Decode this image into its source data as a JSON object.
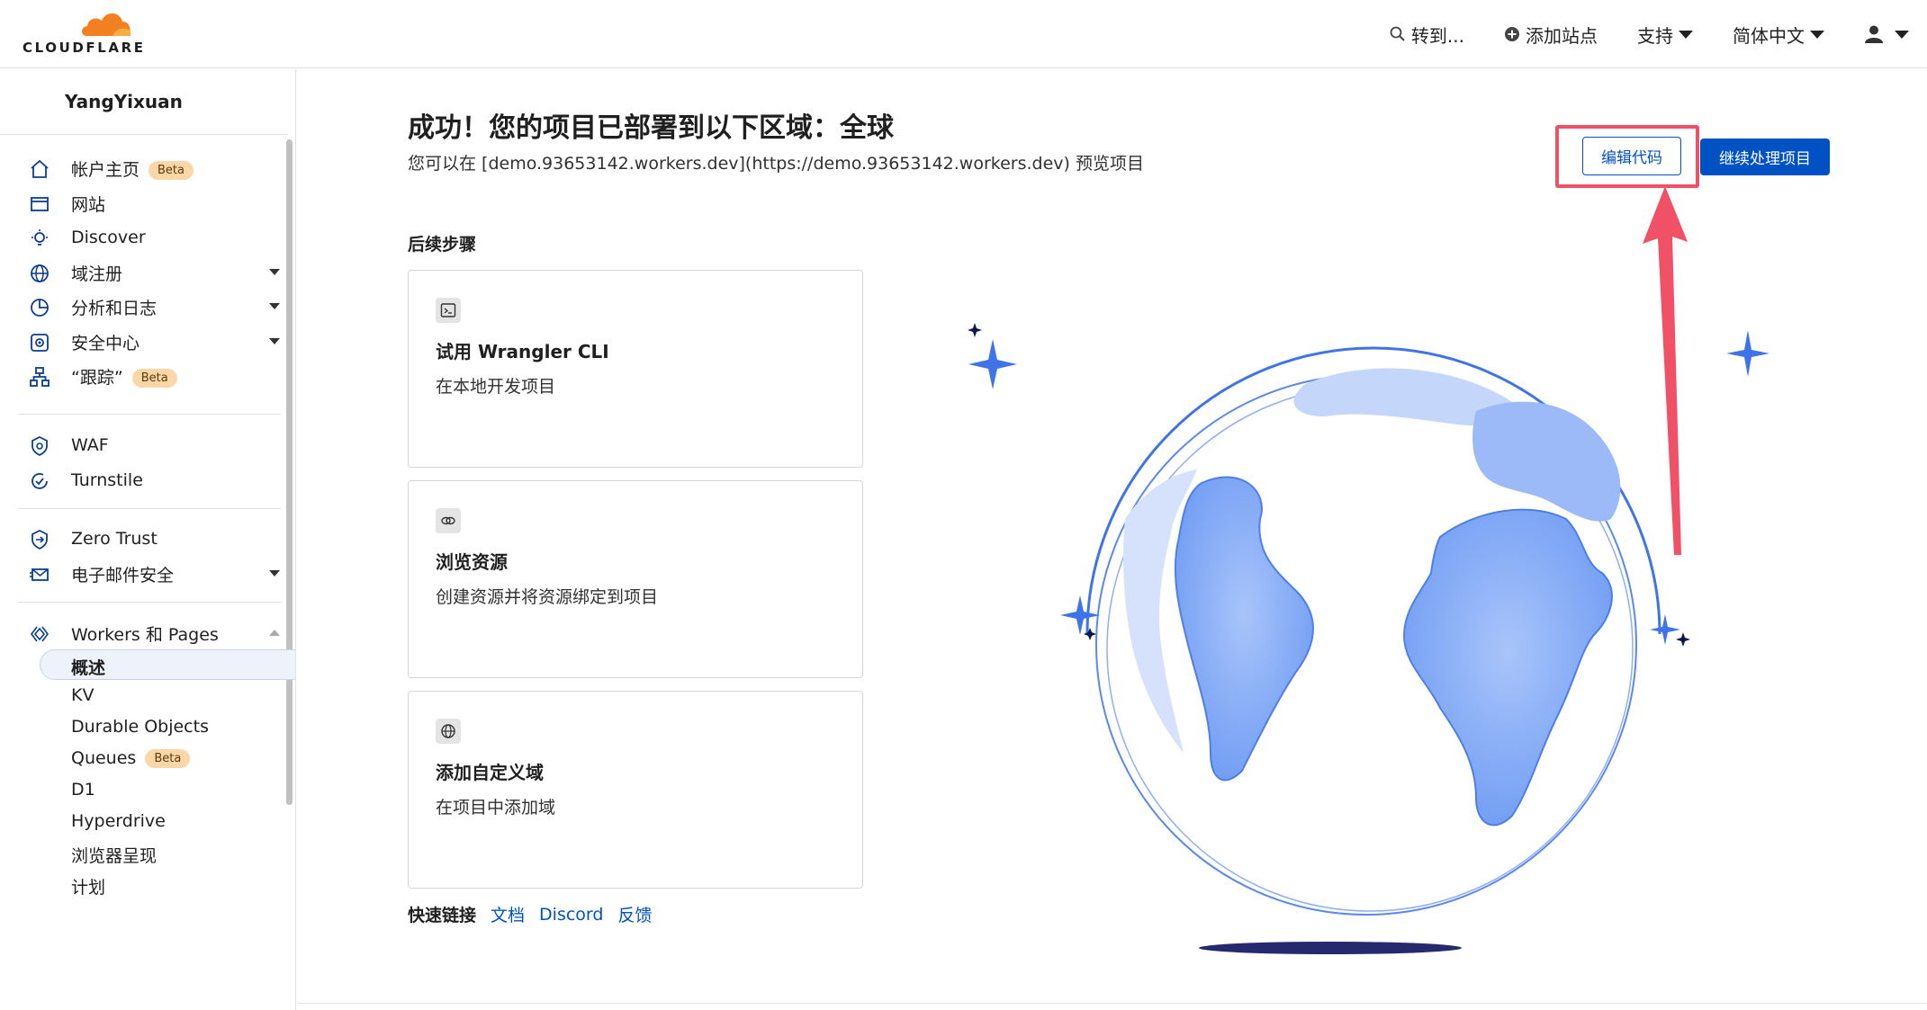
{
  "brand": {
    "logo_text": "CLOUDFLARE",
    "orange": "#f38020",
    "accent_blue": "#0051c3"
  },
  "topnav": {
    "search_label": "转到...",
    "add_site_label": "添加站点",
    "support_label": "支持",
    "language_label": "简体中文",
    "user_icon": "user-icon"
  },
  "sidebar": {
    "account_name": "YangYixuan",
    "items": [
      {
        "label": "帐户主页",
        "icon": "home-icon",
        "badge": "Beta"
      },
      {
        "label": "网站",
        "icon": "browser-window-icon"
      },
      {
        "label": "Discover",
        "icon": "lightbulb-icon"
      },
      {
        "label": "域注册",
        "icon": "globe-icon"
      },
      {
        "label": "分析和日志",
        "icon": "pie-chart-icon"
      },
      {
        "label": "安全中心",
        "icon": "security-center-icon"
      },
      {
        "label": "“跟踪”",
        "icon": "sitemap-icon",
        "badge": "Beta"
      },
      {
        "label": "WAF",
        "icon": "waf-shield-icon"
      },
      {
        "label": "Turnstile",
        "icon": "turnstile-icon"
      },
      {
        "label": "Zero Trust",
        "icon": "zero-trust-icon"
      },
      {
        "label": "电子邮件安全",
        "icon": "email-icon"
      },
      {
        "label": "Workers 和 Pages",
        "icon": "workers-icon"
      }
    ],
    "subitems": [
      {
        "label": "概述",
        "active": true
      },
      {
        "label": "KV"
      },
      {
        "label": "Durable Objects"
      },
      {
        "label": "Queues",
        "badge": "Beta"
      },
      {
        "label": "D1"
      },
      {
        "label": "Hyperdrive"
      },
      {
        "label": "浏览器呈现"
      },
      {
        "label": "计划"
      }
    ]
  },
  "main": {
    "title": "成功！您的项目已部署到以下区域：全球",
    "subtitle": "您可以在 [demo.93653142.workers.dev](https://demo.93653142.workers.dev) 预览项目",
    "edit_code_label": "编辑代码",
    "continue_label": "继续处理项目",
    "steps_heading": "后续步骤",
    "cards": [
      {
        "icon": "terminal-icon",
        "title": "试用 Wrangler CLI",
        "desc": "在本地开发项目"
      },
      {
        "icon": "link-icon",
        "title": "浏览资源",
        "desc": "创建资源并将资源绑定到项目"
      },
      {
        "icon": "globe-icon",
        "title": "添加自定义域",
        "desc": "在项目中添加域"
      }
    ],
    "quick_links_label": "快速链接",
    "quick_links": [
      "文档",
      "Discord",
      "反馈"
    ]
  },
  "annotation": {
    "highlight_color": "#f05166",
    "arrow_color": "#f05166"
  }
}
